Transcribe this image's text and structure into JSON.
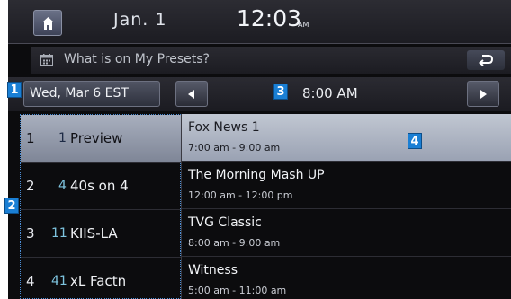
{
  "status_bar": {
    "date": "Jan.  1",
    "time": "12:03",
    "ampm": "AM"
  },
  "title_bar": {
    "title": "What is on My Presets?"
  },
  "date_row": {
    "date": "Wed, Mar 6 EST",
    "time": "8:00 AM"
  },
  "callouts": [
    "1",
    "2",
    "3",
    "4"
  ],
  "channels": [
    {
      "num": "1",
      "ch": "1",
      "name": "Preview",
      "selected": true
    },
    {
      "num": "2",
      "ch": "4",
      "name": "40s on 4",
      "selected": false
    },
    {
      "num": "3",
      "ch": "11",
      "name": "KIIS-LA",
      "selected": false
    },
    {
      "num": "4",
      "ch": "41",
      "name": "xL Factn",
      "selected": false
    }
  ],
  "programs": [
    {
      "title": "Fox News 1",
      "time": "7:00 am - 9:00 am",
      "selected": true
    },
    {
      "title": "The Morning Mash UP",
      "time": "12:00 am - 12:00 pm",
      "selected": false
    },
    {
      "title": "TVG Classic",
      "time": "8:00 am - 9:00 am",
      "selected": false
    },
    {
      "title": "Witness",
      "time": "5:00 am - 11:00 am",
      "selected": false
    }
  ],
  "colors": {
    "callout": "#1a7fd4",
    "channel_number_accent": "#7ec4df",
    "selected_row": "#b3bac8"
  }
}
